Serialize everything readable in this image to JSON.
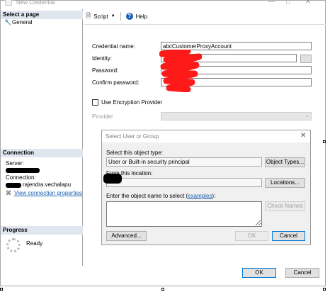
{
  "window": {
    "title": "New Credential"
  },
  "left_pane": {
    "select_page_header": "Select a page",
    "pages": [
      {
        "label": "General"
      }
    ],
    "connection_header": "Connection",
    "server_label": "Server:",
    "connection_label": "Connection:",
    "connection_user": "rajendra.vechalapu",
    "view_props_link": "View connection properties",
    "progress_header": "Progress",
    "progress_status": "Ready"
  },
  "toolbar": {
    "script_label": "Script",
    "help_label": "Help"
  },
  "form": {
    "credential_name_label": "Credential name:",
    "credential_name_value": "abcCustomerProxyAccount",
    "identity_label": "Identity:",
    "password_label": "Password:",
    "confirm_password_label": "Confirm password:",
    "encryption_label": "Use Encryption Provider",
    "provider_label": "Provider"
  },
  "dialog": {
    "title": "Select User or Group",
    "object_type_label": "Select this object type:",
    "object_type_value": "User or Built-in security principal",
    "object_types_button": "Object Types...",
    "location_label": "From this location:",
    "locations_button": "Locations...",
    "enter_name_label": "Enter the object name to select (",
    "examples_link": "examples",
    "enter_name_suffix": "):",
    "check_names_button": "Check Names",
    "advanced_button": "Advanced...",
    "ok_button": "OK",
    "cancel_button": "Cancel"
  },
  "footer": {
    "ok_button": "OK",
    "cancel_button": "Cancel"
  },
  "colors": {
    "accent": "#0078d7",
    "header_bg": "#dfe6ef",
    "redaction": "#ff1a1a"
  }
}
